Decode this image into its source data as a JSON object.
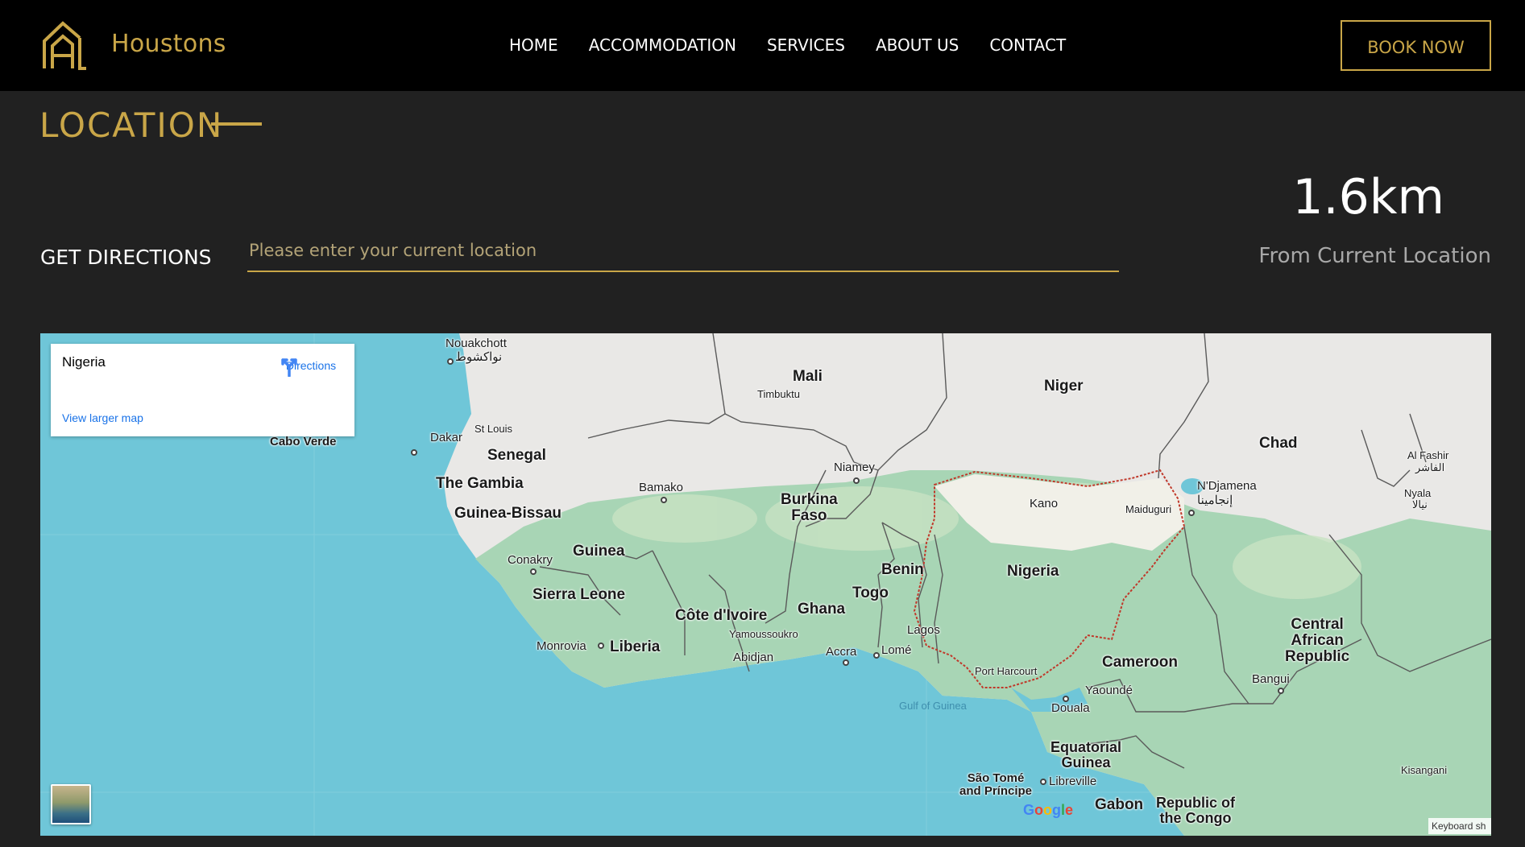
{
  "header": {
    "brand": "Houstons",
    "nav": [
      "HOME",
      "ACCOMMODATION",
      "SERVICES",
      "ABOUT US",
      "CONTACT"
    ],
    "book_button": "BOOK NOW"
  },
  "location": {
    "title": "LOCATION",
    "directions_label": "GET DIRECTIONS",
    "input_placeholder": "Please enter your current location",
    "input_value": "",
    "distance": "1.6km",
    "distance_caption": "From Current Location"
  },
  "map": {
    "card_title": "Nigeria",
    "directions": "Directions",
    "view_larger": "View larger map",
    "keyboard": "Keyboard sh",
    "google": "Google",
    "labels": {
      "nouakchott": "Nouakchott",
      "nouakchott_ar": "نواكشوط",
      "mali": "Mali",
      "timbuktu": "Timbuktu",
      "niger": "Niger",
      "chad": "Chad",
      "al_fashir": "Al Fashir",
      "al_fashir_ar": "الفاشر",
      "nyala": "Nyala",
      "nyala_ar": "نيالا",
      "st_louis": "St Louis",
      "dakar": "Dakar",
      "cabo_verde": "Cabo Verde",
      "senegal": "Senegal",
      "the_gambia": "The Gambia",
      "guinea_bissau": "Guinea-Bissau",
      "bamako": "Bamako",
      "burkina_faso": "Burkina\nFaso",
      "niamey": "Niamey",
      "kano": "Kano",
      "maiduguri": "Maiduguri",
      "ndjamena": "N'Djamena",
      "ndjamena_ar": "إنجامينا",
      "conakry": "Conakry",
      "guinea": "Guinea",
      "benin": "Benin",
      "nigeria": "Nigeria",
      "sierra_leone": "Sierra Leone",
      "togo": "Togo",
      "cote_divoire": "Côte d'Ivoire",
      "ghana": "Ghana",
      "central_african_republic": "Central\nAfrican\nRepublic",
      "monrovia": "Monrovia",
      "liberia": "Liberia",
      "yamoussoukro": "Yamoussoukro",
      "lagos": "Lagos",
      "abidjan": "Abidjan",
      "accra": "Accra",
      "lome": "Lomé",
      "cameroon": "Cameroon",
      "port_harcourt": "Port Harcourt",
      "bangui": "Bangui",
      "yaounde": "Yaoundé",
      "gulf_of_guinea": "Gulf of Guinea",
      "douala": "Douala",
      "equatorial_guinea": "Equatorial\nGuinea",
      "sao_tome": "São Tomé\nand Príncipe",
      "libreville": "Libreville",
      "gabon": "Gabon",
      "republic_of_congo": "Republic of\nthe Congo",
      "kisangani": "Kisangani"
    }
  },
  "colors": {
    "accent": "#c9a648",
    "nav_bg": "#000000",
    "page_bg": "#212121",
    "ocean": "#6fc6d8",
    "land": "#e9e8e6",
    "vegetation": "#a8d5b5",
    "border_highlight": "#c0392b"
  }
}
